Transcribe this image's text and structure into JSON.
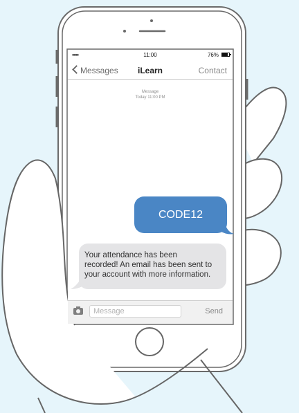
{
  "colors": {
    "background": "#e6f5fb",
    "outgoing_bubble": "#4a86c5",
    "incoming_bubble": "#e4e4e6",
    "outline": "#6a6a6a"
  },
  "status_bar": {
    "signal": "•••••",
    "time": "11:00",
    "battery_percent": "76%",
    "battery_level": 0.76
  },
  "navbar": {
    "back_label": "Messages",
    "title": "iLearn",
    "contact_label": "Contact"
  },
  "thread": {
    "header_label": "Message",
    "header_time": "Today 11:00 PM",
    "messages": [
      {
        "direction": "outgoing",
        "text": "CODE12"
      },
      {
        "direction": "incoming",
        "lines": [
          "Your attendance has been",
          "recorded! An email has been sent to",
          "your account with more information."
        ]
      }
    ]
  },
  "input_bar": {
    "placeholder": "Message",
    "value": "",
    "send_label": "Send"
  },
  "icons": {
    "back": "chevron-left-icon",
    "camera": "camera-icon",
    "battery": "battery-icon",
    "home": "home-button"
  }
}
